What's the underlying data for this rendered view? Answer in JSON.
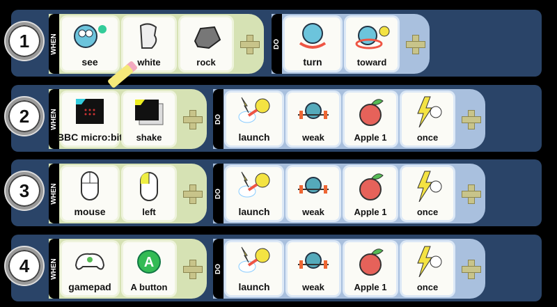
{
  "labels": {
    "when": "WHEN",
    "do": "DO"
  },
  "rules": [
    {
      "number": "1",
      "when": [
        {
          "label": "see",
          "icon": "see-icon"
        },
        {
          "label": "white",
          "icon": "white-paint-icon"
        },
        {
          "label": "rock",
          "icon": "rock-icon"
        }
      ],
      "do": [
        {
          "label": "turn",
          "icon": "turn-icon"
        },
        {
          "label": "toward",
          "icon": "toward-icon"
        }
      ]
    },
    {
      "number": "2",
      "when": [
        {
          "label": "BBC micro:bit",
          "icon": "microbit-icon"
        },
        {
          "label": "shake",
          "icon": "shake-icon"
        }
      ],
      "do": [
        {
          "label": "launch",
          "icon": "launch-icon"
        },
        {
          "label": "weak",
          "icon": "weak-icon"
        },
        {
          "label": "Apple 1",
          "icon": "apple-icon"
        },
        {
          "label": "once",
          "icon": "once-icon"
        }
      ]
    },
    {
      "number": "3",
      "when": [
        {
          "label": "mouse",
          "icon": "mouse-icon"
        },
        {
          "label": "left",
          "icon": "mouse-left-icon"
        }
      ],
      "do": [
        {
          "label": "launch",
          "icon": "launch-icon"
        },
        {
          "label": "weak",
          "icon": "weak-icon"
        },
        {
          "label": "Apple 1",
          "icon": "apple-icon"
        },
        {
          "label": "once",
          "icon": "once-icon"
        }
      ]
    },
    {
      "number": "4",
      "when": [
        {
          "label": "gamepad",
          "icon": "gamepad-icon"
        },
        {
          "label": "A button",
          "icon": "a-button-icon"
        }
      ],
      "do": [
        {
          "label": "launch",
          "icon": "launch-icon"
        },
        {
          "label": "weak",
          "icon": "weak-icon"
        },
        {
          "label": "Apple 1",
          "icon": "apple-icon"
        },
        {
          "label": "once",
          "icon": "once-icon"
        }
      ]
    }
  ],
  "colors": {
    "row_bg": "#2a4468",
    "when_panel": "#d6e2b4",
    "do_panel": "#a9c0de"
  }
}
